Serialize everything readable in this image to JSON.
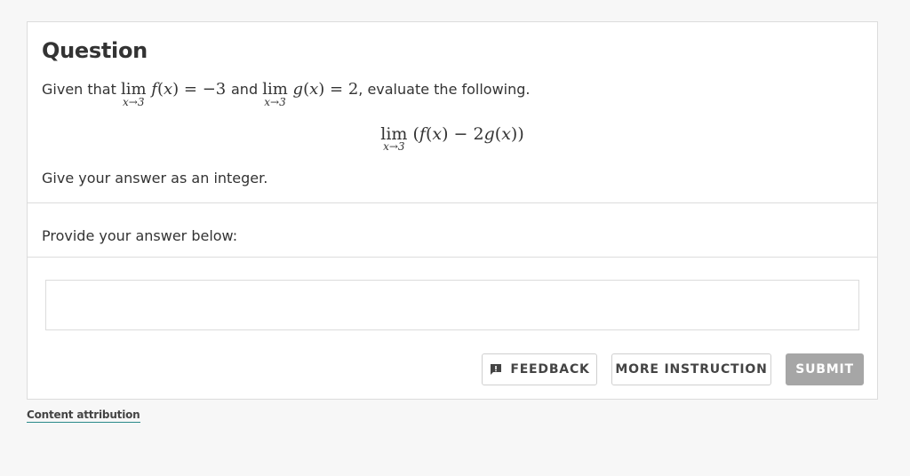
{
  "question": {
    "title": "Question",
    "intro_given": "Given that",
    "intro_and": "and",
    "intro_end": ", evaluate the following.",
    "limit_sub": "x→3",
    "given_f": {
      "func": "f",
      "arg": "x",
      "value": "−3"
    },
    "given_g": {
      "func": "g",
      "arg": "x",
      "value": "2"
    },
    "display_expression": {
      "open": "(",
      "f": "f",
      "x": "x",
      "minus": " − 2",
      "g": "g",
      "close": ")"
    },
    "hint": "Give your answer as an integer."
  },
  "answer": {
    "label": "Provide your answer below:",
    "value": "",
    "placeholder": ""
  },
  "buttons": {
    "feedback": "FEEDBACK",
    "more_instruction": "MORE INSTRUCTION",
    "submit": "SUBMIT"
  },
  "footer": {
    "attribution": "Content attribution"
  },
  "colors": {
    "submit_disabled": "#a6a6a6",
    "attribution_underline": "#2a8a8a"
  },
  "icons": {
    "feedback": "feedback-icon"
  }
}
